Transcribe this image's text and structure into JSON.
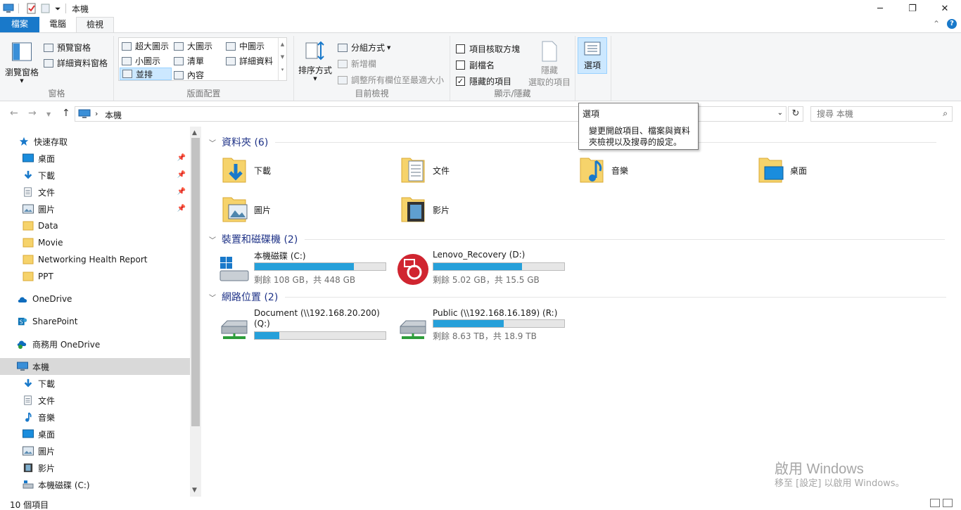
{
  "window": {
    "title": "本機",
    "minimize": "─",
    "maximize": "❐",
    "close": "✕"
  },
  "tabs": {
    "file": "檔案",
    "computer": "電腦",
    "view": "檢視",
    "collapse": "⌃",
    "help": "?"
  },
  "ribbon": {
    "panes": {
      "label": "窗格",
      "nav_pane": "瀏覽窗格",
      "preview_pane": "預覽窗格",
      "details_pane": "詳細資料窗格"
    },
    "layout": {
      "label": "版面配置",
      "extra_large": "超大圖示",
      "large": "大圖示",
      "medium": "中圖示",
      "small": "小圖示",
      "list": "清單",
      "details": "詳細資料",
      "tiles": "並排",
      "content": "內容"
    },
    "current_view": {
      "label": "目前檢視",
      "sort_by": "排序方式",
      "group_by": "分組方式",
      "add_column": "新增欄",
      "size_columns": "調整所有欄位至最適大小"
    },
    "show_hide": {
      "label": "顯示/隱藏",
      "item_checkboxes": "項目核取方塊",
      "extensions": "副檔名",
      "hidden_items": "隱藏的項目",
      "hide_selected_line1": "隱藏",
      "hide_selected_line2": "選取的項目",
      "options": "選項"
    }
  },
  "navigation": {
    "address_location": "本機",
    "search_placeholder": "搜尋 本機"
  },
  "tooltip": {
    "title": "選項",
    "body": "變更開啟項目、檔案與資料夾檢視以及搜尋的設定。"
  },
  "sidebar": {
    "quick_access": "快速存取",
    "quick_items": [
      "桌面",
      "下載",
      "文件",
      "圖片",
      "Data",
      "Movie",
      "Networking Health Report",
      "PPT"
    ],
    "onedrive": "OneDrive",
    "sharepoint": "SharePoint",
    "onedrive_business": "商務用 OneDrive",
    "this_pc": "本機",
    "pc_items": [
      "下載",
      "文件",
      "音樂",
      "桌面",
      "圖片",
      "影片",
      "本機磁碟 (C:)"
    ]
  },
  "content": {
    "folders_header": "資料夾 (6)",
    "folders": [
      "下載",
      "文件",
      "音樂",
      "桌面",
      "圖片",
      "影片"
    ],
    "devices_header": "裝置和磁碟機 (2)",
    "drives": [
      {
        "name": "本機磁碟 (C:)",
        "free": "剩餘 108 GB，共 448 GB",
        "used_fraction": 0.76
      },
      {
        "name": "Lenovo_Recovery (D:)",
        "free": "剩餘 5.02 GB，共 15.5 GB",
        "used_fraction": 0.68
      }
    ],
    "network_header": "網路位置 (2)",
    "network": [
      {
        "name_line1": "Document (\\\\192.168.20.200)",
        "name_line2": "(Q:)",
        "used_fraction": 0.19
      },
      {
        "name_line1": "Public (\\\\192.168.16.189) (R:)",
        "free": "剩餘 8.63 TB，共 18.9 TB",
        "used_fraction": 0.54
      }
    ]
  },
  "watermark": {
    "line1": "啟用 Windows",
    "line2": "移至 [設定] 以啟用 Windows。"
  },
  "status": {
    "item_count": "10 個項目"
  },
  "colors": {
    "accent": "#1979ca",
    "bar_fill": "#26a0da",
    "section_text": "#1e3287",
    "folder": "#f6d36b"
  }
}
